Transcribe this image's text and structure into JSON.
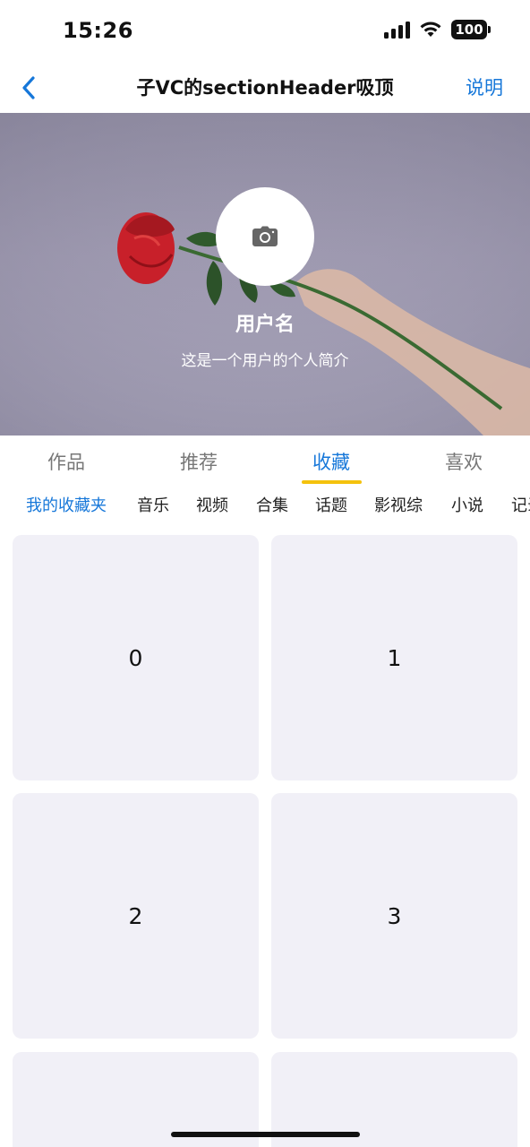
{
  "status_bar": {
    "time": "15:26",
    "battery": "100",
    "icons": [
      "signal-icon",
      "wifi-icon",
      "battery-icon"
    ]
  },
  "nav": {
    "back_icon": "chevron-left-icon",
    "title": "子VC的sectionHeader吸顶",
    "right_label": "说明"
  },
  "profile": {
    "avatar_icon": "camera-icon",
    "username": "用户名",
    "bio": "这是一个用户的个人简介"
  },
  "main_tabs": [
    {
      "label": "作品",
      "active": false
    },
    {
      "label": "推荐",
      "active": false
    },
    {
      "label": "收藏",
      "active": true
    },
    {
      "label": "喜欢",
      "active": false
    }
  ],
  "sub_tabs": [
    {
      "label": "我的收藏夹",
      "active": true
    },
    {
      "label": "音乐",
      "active": false
    },
    {
      "label": "视频",
      "active": false
    },
    {
      "label": "合集",
      "active": false
    },
    {
      "label": "话题",
      "active": false
    },
    {
      "label": "影视综",
      "active": false
    },
    {
      "label": "小说",
      "active": false
    },
    {
      "label": "记录",
      "active": false
    }
  ],
  "grid_items": [
    "0",
    "1",
    "2",
    "3",
    "",
    ""
  ],
  "colors": {
    "accent": "#1677d9",
    "indicator": "#f4c20d",
    "cell_bg": "#f1f0f7"
  }
}
